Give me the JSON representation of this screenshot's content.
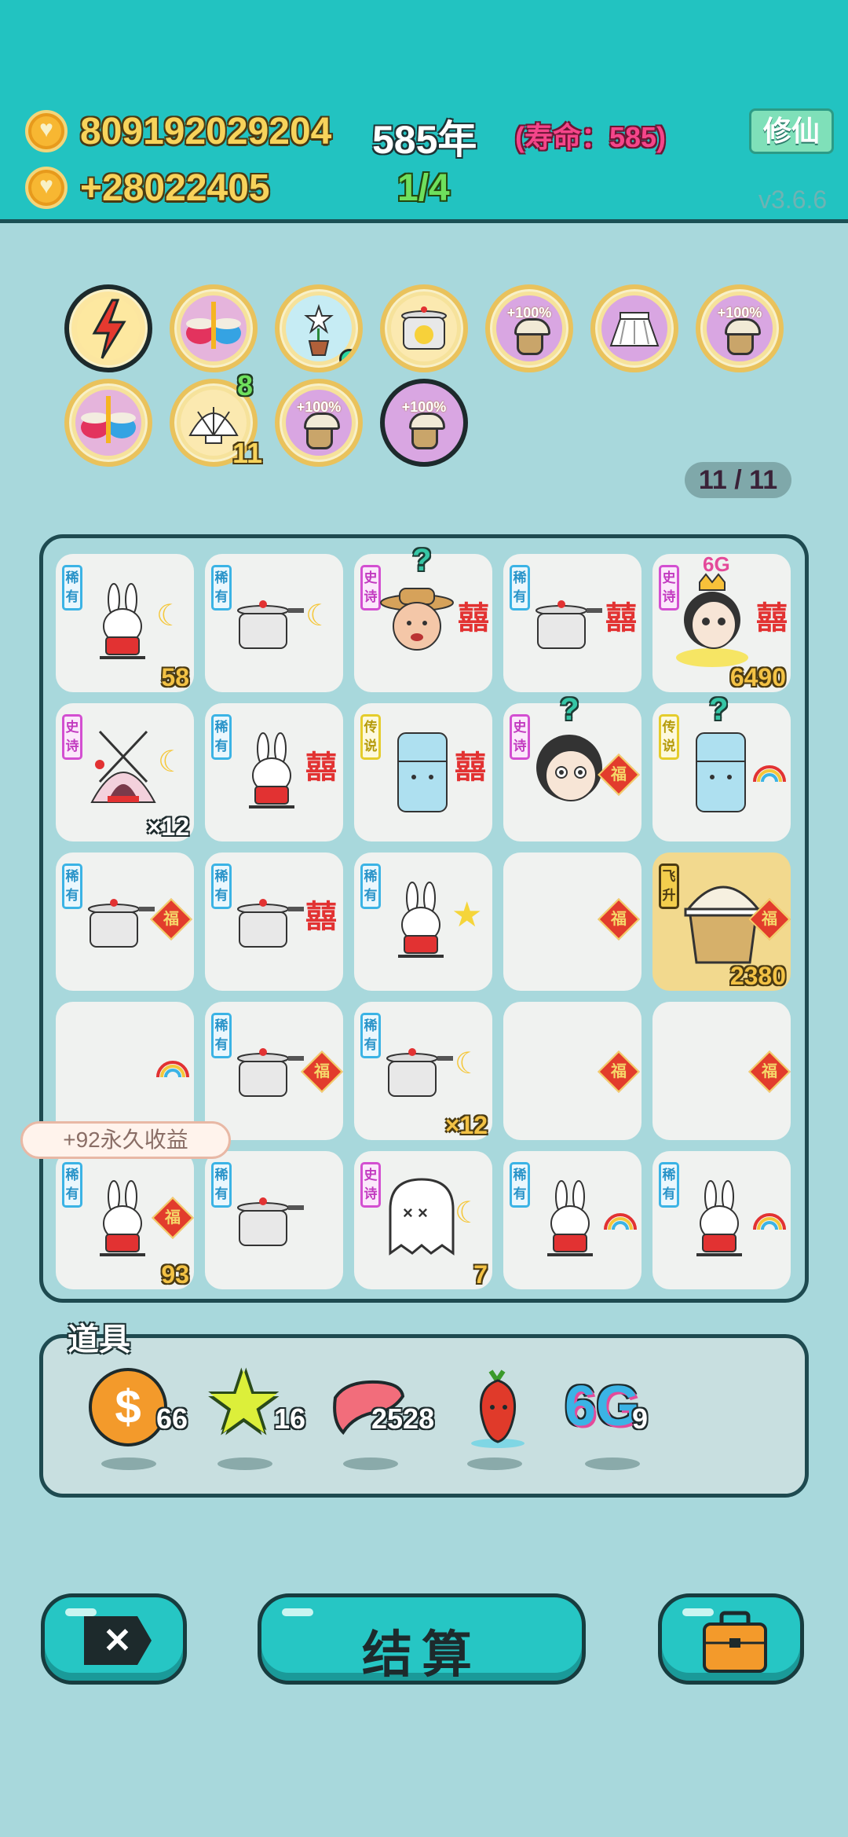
{
  "header": {
    "coins": "809192029204",
    "years": "585年",
    "lifespan": "(寿命：585)",
    "income": "+28022405",
    "progress": "1/4",
    "xiuxian_label": "修仙",
    "version": "v3.6.6"
  },
  "buffs": [
    {
      "icon": "lightning-icon",
      "label": ""
    },
    {
      "icon": "rice-bowls-icon",
      "label": ""
    },
    {
      "icon": "flower-pot-icon",
      "label": ""
    },
    {
      "icon": "duck-pot-icon",
      "label": ""
    },
    {
      "icon": "bucket-icon",
      "label": "+100%"
    },
    {
      "icon": "skirt-icon",
      "label": ""
    },
    {
      "icon": "bucket-icon",
      "label": "+100%"
    },
    {
      "icon": "rice-bowls-icon",
      "label": ""
    },
    {
      "icon": "shell-icon",
      "label": "",
      "count_top": "8",
      "count_bottom": "11"
    },
    {
      "icon": "bucket-icon",
      "label": "+100%"
    },
    {
      "icon": "bucket-icon",
      "label": "+100%"
    }
  ],
  "counter": "11 / 11",
  "tags": {
    "rare": "稀有",
    "epic": "史诗",
    "legend": "传说",
    "fly": "飞升"
  },
  "cells": {
    "c00": "58",
    "c04": "6490",
    "c04_badge": "6G",
    "c10": "×12",
    "c24": "2380",
    "c32": "×12",
    "c40": "93",
    "c42": "7"
  },
  "tooltip": "+92永久收益",
  "props": {
    "title": "道具",
    "items": [
      {
        "icon": "dollar-coin-icon",
        "count": "66"
      },
      {
        "icon": "star-icon",
        "count": "16"
      },
      {
        "icon": "liver-icon",
        "count": "2528"
      },
      {
        "icon": "chili-icon",
        "count": ""
      },
      {
        "icon": "6g-icon",
        "label": "6G",
        "count": "9"
      }
    ]
  },
  "buttons": {
    "settle": "结算"
  },
  "colors": {
    "header": "#22c3c1",
    "background": "#a8d8dc",
    "accent_gold": "#f7d35b"
  }
}
